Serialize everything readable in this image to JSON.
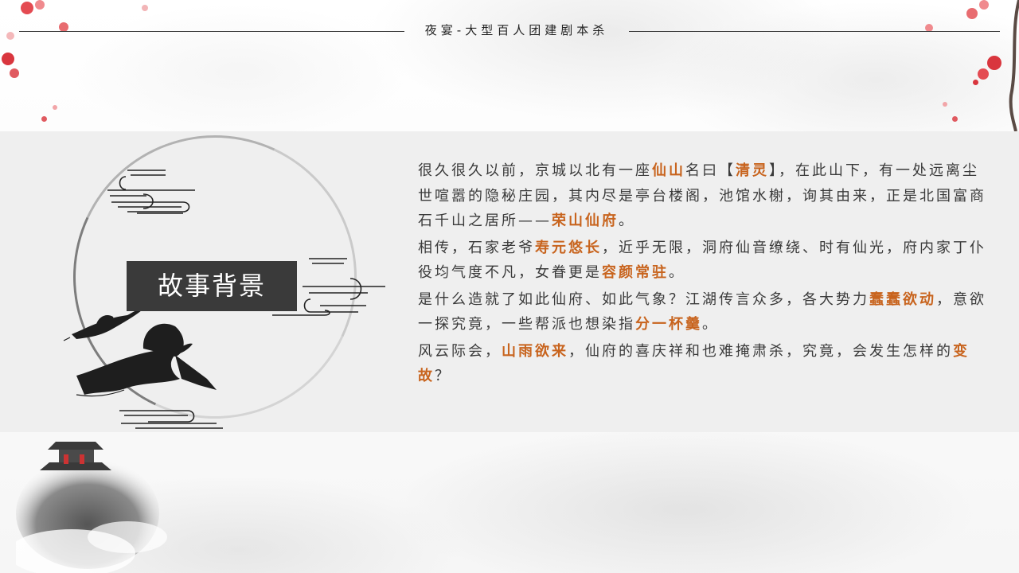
{
  "header": {
    "title": "夜宴-大型百人团建剧本杀"
  },
  "section": {
    "title": "故事背景"
  },
  "story": {
    "p1": {
      "t1": "很久很久以前，京城以北有一座",
      "h1": "仙山",
      "t2": "名曰【",
      "h2": "清灵",
      "t3": "】，在此山下，有一处远离尘世喧嚣的隐秘庄园，其内尽是亭台楼阁，池馆水榭，询其由来，正是北国富商石千山之居所——",
      "h3": "荣山仙府",
      "t4": "。"
    },
    "p2": {
      "t1": "相传，石家老爷",
      "h1": "寿元悠长",
      "t2": "，近乎无限，洞府仙音缭绕、时有仙光，府内家丁仆役均气度不凡，女眷更是",
      "h2": "容颜常驻",
      "t3": "。"
    },
    "p3": {
      "t1": "是什么造就了如此仙府、如此气象？江湖传言众多，各大势力",
      "h1": "蠢蠢欲动",
      "t2": "，意欲一探究竟，一些帮派也想染指",
      "h2": "分一杯羹",
      "t3": "。"
    },
    "p4": {
      "t1": "风云际会，",
      "h1": "山雨欲来",
      "t2": "，仙府的喜庆祥和也难掩肃杀，究竟，会发生怎样的",
      "h2": "变故",
      "t3": "？"
    }
  },
  "colors": {
    "accent": "#c8641e",
    "title_box": "#3a3a3a",
    "panel": "#efefef",
    "blossom": "#d9363e"
  },
  "icons": [
    "cloud-pattern-icon",
    "crane-icon",
    "plum-blossom-icon",
    "pagoda-mountain-icon"
  ]
}
